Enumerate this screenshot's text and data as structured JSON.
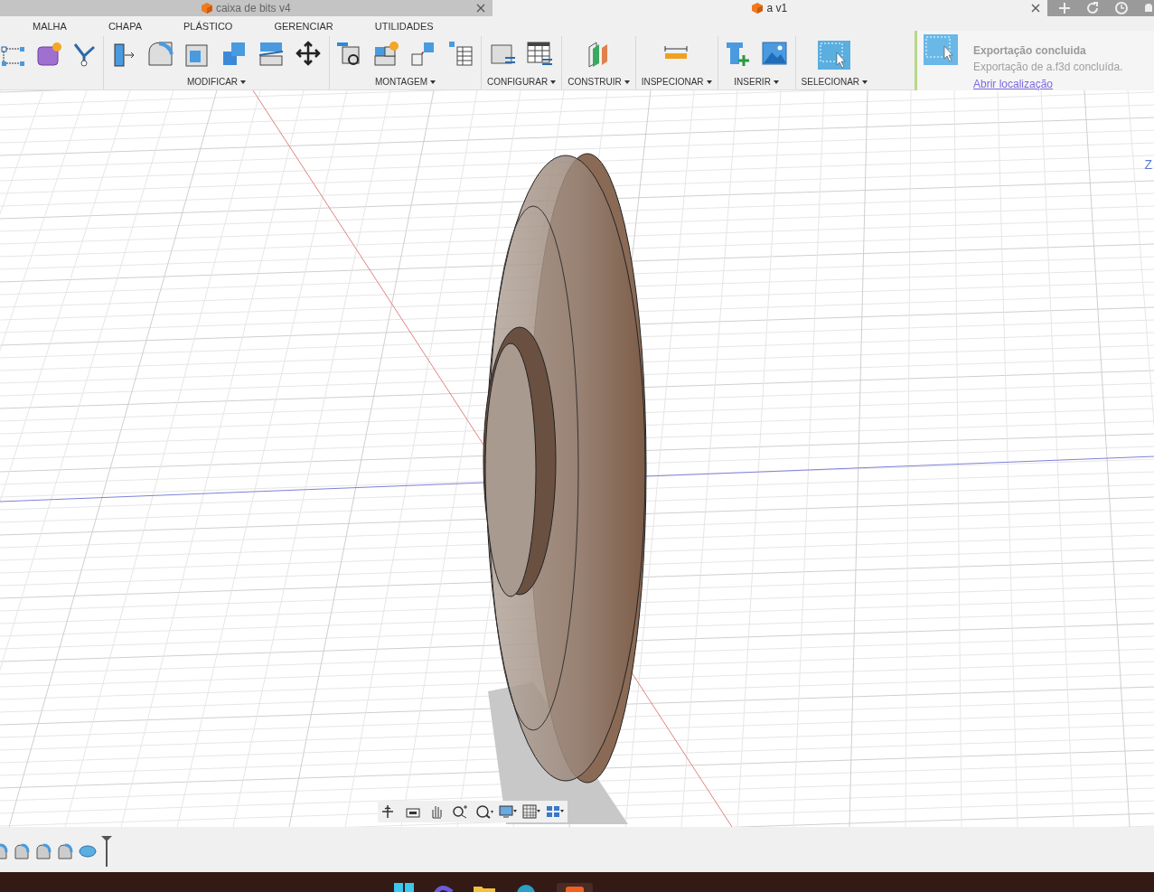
{
  "tabs": [
    {
      "label": "caixa de bits v4",
      "selected": false
    },
    {
      "label": "a v1",
      "selected": true
    }
  ],
  "menu": [
    "MALHA",
    "CHAPA",
    "PLÁSTICO",
    "GERENCIAR",
    "UTILIDADES"
  ],
  "toolbar_groups": [
    {
      "label": "MODIFICAR"
    },
    {
      "label": "MONTAGEM"
    },
    {
      "label": "CONFIGURAR"
    },
    {
      "label": "CONSTRUIR"
    },
    {
      "label": "INSPECIONAR"
    },
    {
      "label": "INSERIR"
    },
    {
      "label": "SELECIONAR"
    }
  ],
  "notification": {
    "title": "Exportação concluida",
    "message": "Exportação de a.f3d concluída.",
    "link": "Abrir localização"
  },
  "viewcube_axis": "Z"
}
